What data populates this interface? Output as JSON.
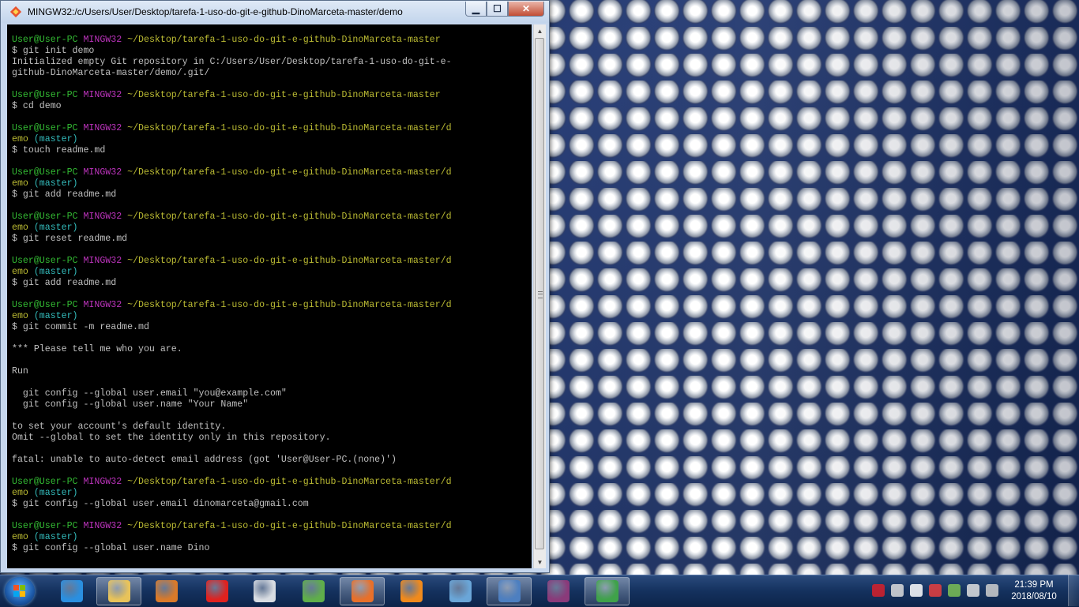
{
  "window": {
    "title": "MINGW32:/c/Users/User/Desktop/tarefa-1-uso-do-git-e-github-DinoMarceta-master/demo",
    "minimize_label": "▁",
    "maximize_label": "☐",
    "close_label": "✕"
  },
  "terminal": {
    "lines": [
      [
        {
          "t": "User@User-PC ",
          "c": "green"
        },
        {
          "t": "MINGW32 ",
          "c": "mag"
        },
        {
          "t": "~/Desktop/tarefa-1-uso-do-git-e-github-DinoMarceta-master",
          "c": "yel"
        }
      ],
      [
        {
          "t": "$ git init demo",
          "c": ""
        }
      ],
      [
        {
          "t": "Initialized empty Git repository in C:/Users/User/Desktop/tarefa-1-uso-do-git-e-",
          "c": ""
        }
      ],
      [
        {
          "t": "github-DinoMarceta-master/demo/.git/",
          "c": ""
        }
      ],
      [
        {
          "t": "",
          "c": ""
        }
      ],
      [
        {
          "t": "User@User-PC ",
          "c": "green"
        },
        {
          "t": "MINGW32 ",
          "c": "mag"
        },
        {
          "t": "~/Desktop/tarefa-1-uso-do-git-e-github-DinoMarceta-master",
          "c": "yel"
        }
      ],
      [
        {
          "t": "$ cd demo",
          "c": ""
        }
      ],
      [
        {
          "t": "",
          "c": ""
        }
      ],
      [
        {
          "t": "User@User-PC ",
          "c": "green"
        },
        {
          "t": "MINGW32 ",
          "c": "mag"
        },
        {
          "t": "~/Desktop/tarefa-1-uso-do-git-e-github-DinoMarceta-master/d",
          "c": "yel"
        }
      ],
      [
        {
          "t": "emo ",
          "c": "yel"
        },
        {
          "t": "(master)",
          "c": "cyan"
        }
      ],
      [
        {
          "t": "$ touch readme.md",
          "c": ""
        }
      ],
      [
        {
          "t": "",
          "c": ""
        }
      ],
      [
        {
          "t": "User@User-PC ",
          "c": "green"
        },
        {
          "t": "MINGW32 ",
          "c": "mag"
        },
        {
          "t": "~/Desktop/tarefa-1-uso-do-git-e-github-DinoMarceta-master/d",
          "c": "yel"
        }
      ],
      [
        {
          "t": "emo ",
          "c": "yel"
        },
        {
          "t": "(master)",
          "c": "cyan"
        }
      ],
      [
        {
          "t": "$ git add readme.md",
          "c": ""
        }
      ],
      [
        {
          "t": "",
          "c": ""
        }
      ],
      [
        {
          "t": "User@User-PC ",
          "c": "green"
        },
        {
          "t": "MINGW32 ",
          "c": "mag"
        },
        {
          "t": "~/Desktop/tarefa-1-uso-do-git-e-github-DinoMarceta-master/d",
          "c": "yel"
        }
      ],
      [
        {
          "t": "emo ",
          "c": "yel"
        },
        {
          "t": "(master)",
          "c": "cyan"
        }
      ],
      [
        {
          "t": "$ git reset readme.md",
          "c": ""
        }
      ],
      [
        {
          "t": "",
          "c": ""
        }
      ],
      [
        {
          "t": "User@User-PC ",
          "c": "green"
        },
        {
          "t": "MINGW32 ",
          "c": "mag"
        },
        {
          "t": "~/Desktop/tarefa-1-uso-do-git-e-github-DinoMarceta-master/d",
          "c": "yel"
        }
      ],
      [
        {
          "t": "emo ",
          "c": "yel"
        },
        {
          "t": "(master)",
          "c": "cyan"
        }
      ],
      [
        {
          "t": "$ git add readme.md",
          "c": ""
        }
      ],
      [
        {
          "t": "",
          "c": ""
        }
      ],
      [
        {
          "t": "User@User-PC ",
          "c": "green"
        },
        {
          "t": "MINGW32 ",
          "c": "mag"
        },
        {
          "t": "~/Desktop/tarefa-1-uso-do-git-e-github-DinoMarceta-master/d",
          "c": "yel"
        }
      ],
      [
        {
          "t": "emo ",
          "c": "yel"
        },
        {
          "t": "(master)",
          "c": "cyan"
        }
      ],
      [
        {
          "t": "$ git commit -m readme.md",
          "c": ""
        }
      ],
      [
        {
          "t": "",
          "c": ""
        }
      ],
      [
        {
          "t": "*** Please tell me who you are.",
          "c": ""
        }
      ],
      [
        {
          "t": "",
          "c": ""
        }
      ],
      [
        {
          "t": "Run",
          "c": ""
        }
      ],
      [
        {
          "t": "",
          "c": ""
        }
      ],
      [
        {
          "t": "  git config --global user.email \"you@example.com\"",
          "c": ""
        }
      ],
      [
        {
          "t": "  git config --global user.name \"Your Name\"",
          "c": ""
        }
      ],
      [
        {
          "t": "",
          "c": ""
        }
      ],
      [
        {
          "t": "to set your account's default identity.",
          "c": ""
        }
      ],
      [
        {
          "t": "Omit --global to set the identity only in this repository.",
          "c": ""
        }
      ],
      [
        {
          "t": "",
          "c": ""
        }
      ],
      [
        {
          "t": "fatal: unable to auto-detect email address (got 'User@User-PC.(none)')",
          "c": ""
        }
      ],
      [
        {
          "t": "",
          "c": ""
        }
      ],
      [
        {
          "t": "User@User-PC ",
          "c": "green"
        },
        {
          "t": "MINGW32 ",
          "c": "mag"
        },
        {
          "t": "~/Desktop/tarefa-1-uso-do-git-e-github-DinoMarceta-master/d",
          "c": "yel"
        }
      ],
      [
        {
          "t": "emo ",
          "c": "yel"
        },
        {
          "t": "(master)",
          "c": "cyan"
        }
      ],
      [
        {
          "t": "$ git config --global user.email dinomarceta@gmail.com",
          "c": ""
        }
      ],
      [
        {
          "t": "",
          "c": ""
        }
      ],
      [
        {
          "t": "User@User-PC ",
          "c": "green"
        },
        {
          "t": "MINGW32 ",
          "c": "mag"
        },
        {
          "t": "~/Desktop/tarefa-1-uso-do-git-e-github-DinoMarceta-master/d",
          "c": "yel"
        }
      ],
      [
        {
          "t": "emo ",
          "c": "yel"
        },
        {
          "t": "(master)",
          "c": "cyan"
        }
      ],
      [
        {
          "t": "$ git config --global user.name Dino",
          "c": ""
        }
      ]
    ]
  },
  "taskbar": {
    "items": [
      {
        "name": "internet-explorer-icon",
        "color": "#2a8fe0",
        "active": false
      },
      {
        "name": "file-explorer-icon",
        "color": "#e8c35a",
        "active": true
      },
      {
        "name": "media-player-icon",
        "color": "#d97a2a",
        "active": false
      },
      {
        "name": "opera-icon",
        "color": "#e0221f",
        "active": false
      },
      {
        "name": "document-viewer-icon",
        "color": "#d8dce2",
        "active": false
      },
      {
        "name": "notepad-chart-icon",
        "color": "#5fae4a",
        "active": false
      },
      {
        "name": "firefox-icon",
        "color": "#e8702a",
        "active": true
      },
      {
        "name": "vlc-icon",
        "color": "#f08a1c",
        "active": false
      },
      {
        "name": "control-panel-icon",
        "color": "#6aa6d8",
        "active": false
      },
      {
        "name": "remote-desktop-icon",
        "color": "#4d7fc0",
        "active": true
      },
      {
        "name": "winrar-icon",
        "color": "#8a3a7a",
        "active": false
      },
      {
        "name": "git-gui-icon",
        "color": "#3fa24a",
        "active": true
      }
    ]
  },
  "tray": {
    "icons": [
      "acrobat-icon",
      "webcam-icon",
      "signal-icon",
      "flag-error-icon",
      "network-icon",
      "volume-icon",
      "power-icon"
    ]
  },
  "clock": {
    "time": "21:39 PM",
    "date": "2018/08/10"
  }
}
